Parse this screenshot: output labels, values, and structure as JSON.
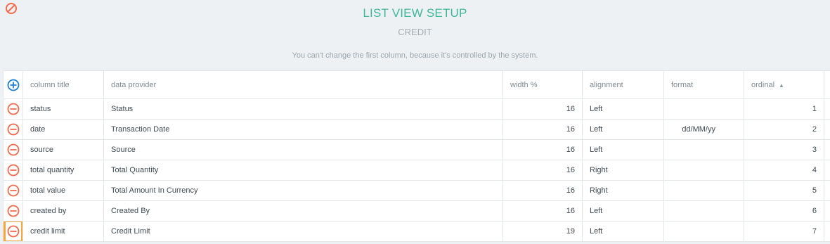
{
  "header": {
    "title": "LIST VIEW SETUP",
    "subtitle": "CREDIT",
    "hint": "You can't change the first column, because it's controlled by the system."
  },
  "colors": {
    "accent": "#3db89a",
    "add": "#1f7fd0",
    "remove": "#f26b4e",
    "highlight": "#f4a83a"
  },
  "table": {
    "columns": [
      {
        "label": "column title"
      },
      {
        "label": "data provider"
      },
      {
        "label": "width %"
      },
      {
        "label": "alignment"
      },
      {
        "label": "format"
      },
      {
        "label": "ordinal",
        "sort_icon": "▲"
      }
    ],
    "rows": [
      {
        "title": "status",
        "provider": "Status",
        "width": "16",
        "alignment": "Left",
        "format": "",
        "ordinal": "1"
      },
      {
        "title": "date",
        "provider": "Transaction Date",
        "width": "16",
        "alignment": "Left",
        "format": "dd/MM/yy",
        "ordinal": "2"
      },
      {
        "title": "source",
        "provider": "Source",
        "width": "16",
        "alignment": "Left",
        "format": "",
        "ordinal": "3"
      },
      {
        "title": "total quantity",
        "provider": "Total Quantity",
        "width": "16",
        "alignment": "Right",
        "format": "",
        "ordinal": "4"
      },
      {
        "title": "total value",
        "provider": "Total Amount In Currency",
        "width": "16",
        "alignment": "Right",
        "format": "",
        "ordinal": "5"
      },
      {
        "title": "created by",
        "provider": "Created By",
        "width": "16",
        "alignment": "Left",
        "format": "",
        "ordinal": "6"
      },
      {
        "title": "credit limit",
        "provider": "Credit Limit",
        "width": "19",
        "alignment": "Left",
        "format": "",
        "ordinal": "7"
      }
    ]
  }
}
